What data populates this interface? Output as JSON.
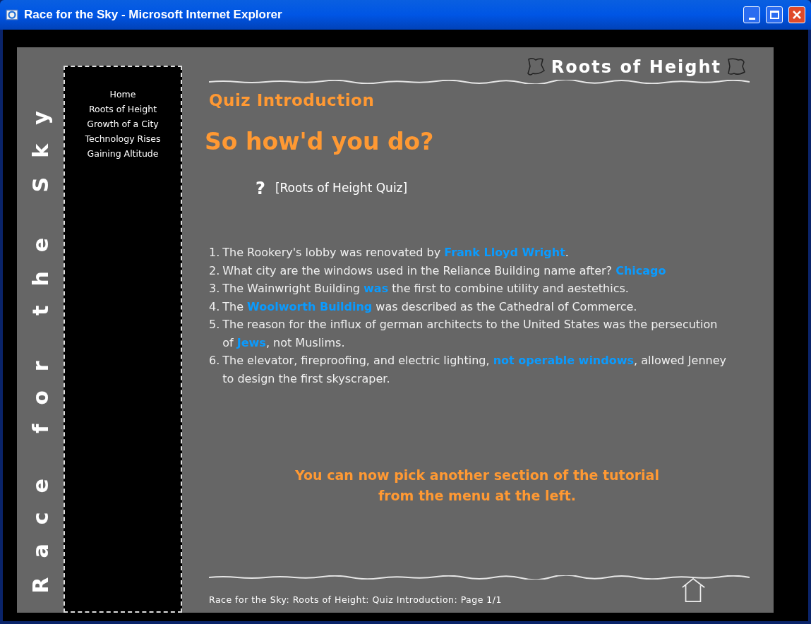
{
  "window": {
    "title": "Race for the Sky - Microsoft Internet Explorer"
  },
  "site_title": "Race for the Sky",
  "nav": {
    "items": [
      {
        "label": "Home"
      },
      {
        "label": "Roots of Height"
      },
      {
        "label": "Growth of a City"
      },
      {
        "label": "Technology Rises"
      },
      {
        "label": "Gaining Altitude"
      }
    ]
  },
  "section_banner": "Roots of Height",
  "page_heading": "Quiz Introduction",
  "headline": "So how'd you do?",
  "quiz_link": {
    "icon": "?",
    "label": "[Roots of Height Quiz]"
  },
  "answers": [
    {
      "number": "1.",
      "text": "The Rookery's lobby was renovated by **Frank Lloyd Wright**."
    },
    {
      "number": "2.",
      "text": "What city are the windows used in the Reliance Building name after? **Chicago**"
    },
    {
      "number": "3.",
      "text": "The Wainwright Building **was** the first to combine utility and aestethics."
    },
    {
      "number": "4.",
      "text": "The **Woolworth Building** was described as the Cathedral of Commerce."
    },
    {
      "number": "5.",
      "text": "The reason for the influx of german architects to the United States was the persecution of **Jews**, not Muslims."
    },
    {
      "number": "6.",
      "text": "The elevator, fireproofing, and electric lighting, **not operable windows**, allowed Jenney to design the first skyscraper."
    }
  ],
  "closing_note": [
    "You can now pick another section of the tutorial",
    "from the menu at the left."
  ],
  "footer": {
    "breadcrumb": "Race for the Sky: Roots of Height: Quiz Introduction: Page 1/1"
  }
}
